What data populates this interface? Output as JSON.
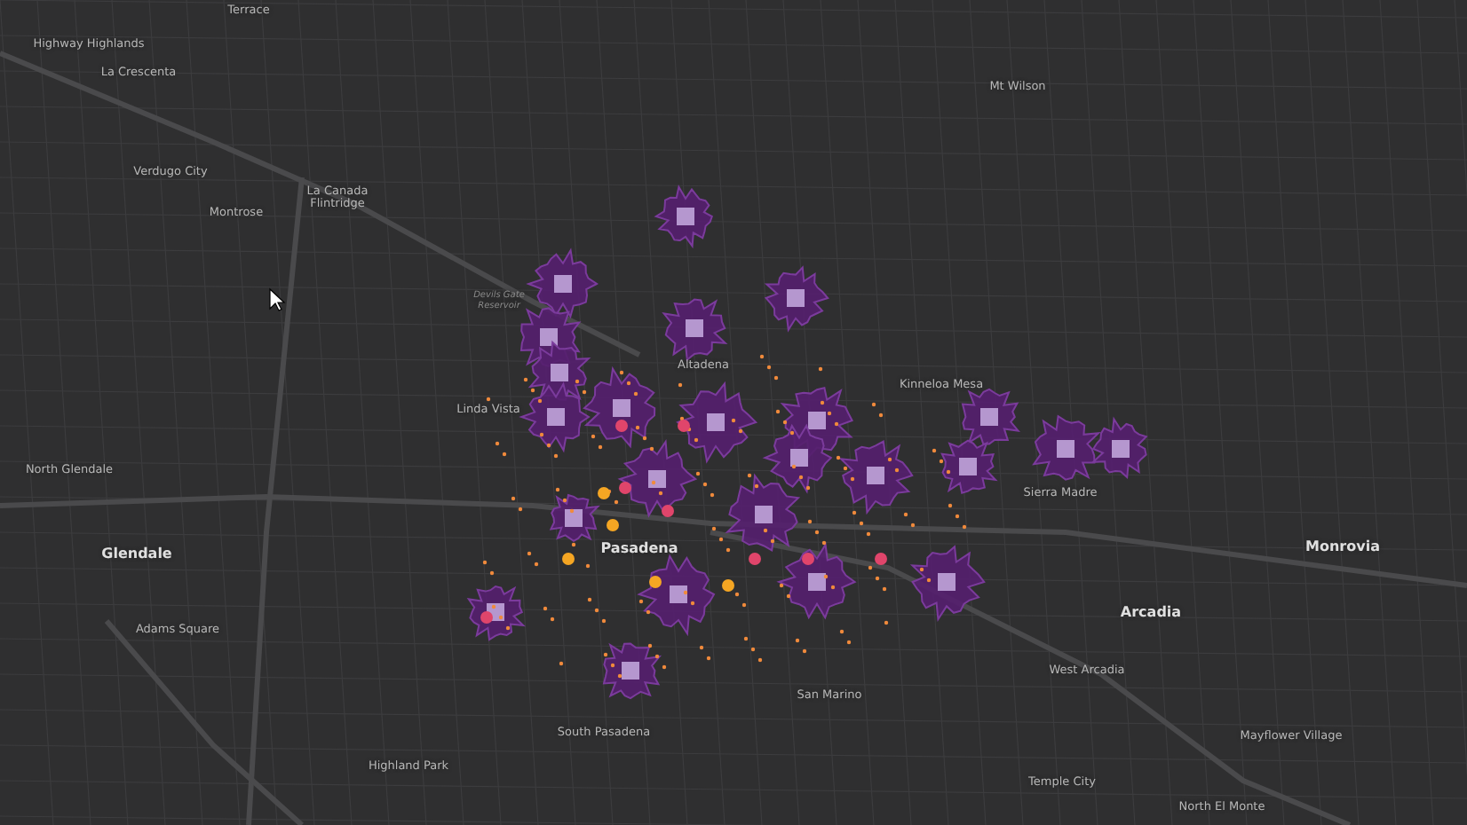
{
  "map": {
    "labels": [
      {
        "text": "Terrace",
        "kind": "place"
      },
      {
        "text": "Highway Highlands",
        "kind": "place"
      },
      {
        "text": "La Crescenta",
        "kind": "place"
      },
      {
        "text": "Verdugo City",
        "kind": "place"
      },
      {
        "text": "Montrose",
        "kind": "place"
      },
      {
        "text": "La Canada Flintridge",
        "kind": "place"
      },
      {
        "text": "Mt Wilson",
        "kind": "place"
      },
      {
        "text": "Altadena",
        "kind": "place"
      },
      {
        "text": "Devils Gate Reservoir",
        "kind": "water"
      },
      {
        "text": "Kinneloa Mesa",
        "kind": "place"
      },
      {
        "text": "Linda Vista",
        "kind": "place"
      },
      {
        "text": "North Glendale",
        "kind": "place"
      },
      {
        "text": "Glendale",
        "kind": "city"
      },
      {
        "text": "Pasadena",
        "kind": "city"
      },
      {
        "text": "Sierra Madre",
        "kind": "place"
      },
      {
        "text": "Monrovia",
        "kind": "city"
      },
      {
        "text": "Arcadia",
        "kind": "city"
      },
      {
        "text": "Adams Square",
        "kind": "place"
      },
      {
        "text": "West Arcadia",
        "kind": "place"
      },
      {
        "text": "San Marino",
        "kind": "place"
      },
      {
        "text": "South Pasadena",
        "kind": "place"
      },
      {
        "text": "Highland Park",
        "kind": "place"
      },
      {
        "text": "Temple City",
        "kind": "place"
      },
      {
        "text": "Mayflower Village",
        "kind": "place"
      },
      {
        "text": "North El Monte",
        "kind": "place"
      }
    ]
  }
}
